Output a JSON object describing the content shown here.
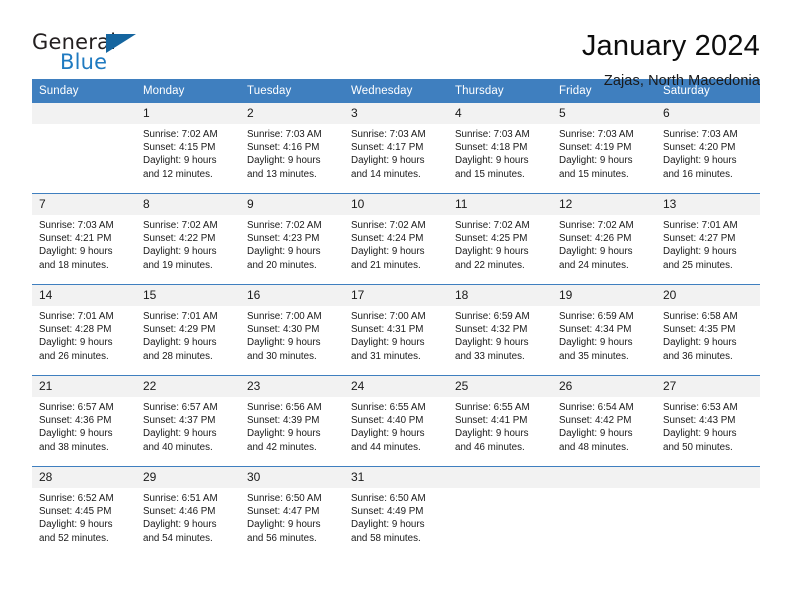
{
  "logo": {
    "word_one": "General",
    "word_two": "Blue",
    "triangle_color": "#15659f",
    "blue_text_color": "#1f7ac0"
  },
  "header": {
    "title": "January 2024",
    "subtitle": "Zajas, North Macedonia"
  },
  "theme": {
    "header_bg": "#3f7fbf",
    "header_text": "#ffffff",
    "daynum_bg": "#f2f2f2",
    "cell_bg": "#ffffff",
    "divider": "#3f7fbf"
  },
  "calendar": {
    "weekday_headers": [
      "Sunday",
      "Monday",
      "Tuesday",
      "Wednesday",
      "Thursday",
      "Friday",
      "Saturday"
    ],
    "weeks": [
      [
        {
          "day": "",
          "lines": []
        },
        {
          "day": "1",
          "lines": [
            "Sunrise: 7:02 AM",
            "Sunset: 4:15 PM",
            "Daylight: 9 hours",
            "and 12 minutes."
          ]
        },
        {
          "day": "2",
          "lines": [
            "Sunrise: 7:03 AM",
            "Sunset: 4:16 PM",
            "Daylight: 9 hours",
            "and 13 minutes."
          ]
        },
        {
          "day": "3",
          "lines": [
            "Sunrise: 7:03 AM",
            "Sunset: 4:17 PM",
            "Daylight: 9 hours",
            "and 14 minutes."
          ]
        },
        {
          "day": "4",
          "lines": [
            "Sunrise: 7:03 AM",
            "Sunset: 4:18 PM",
            "Daylight: 9 hours",
            "and 15 minutes."
          ]
        },
        {
          "day": "5",
          "lines": [
            "Sunrise: 7:03 AM",
            "Sunset: 4:19 PM",
            "Daylight: 9 hours",
            "and 15 minutes."
          ]
        },
        {
          "day": "6",
          "lines": [
            "Sunrise: 7:03 AM",
            "Sunset: 4:20 PM",
            "Daylight: 9 hours",
            "and 16 minutes."
          ]
        }
      ],
      [
        {
          "day": "7",
          "lines": [
            "Sunrise: 7:03 AM",
            "Sunset: 4:21 PM",
            "Daylight: 9 hours",
            "and 18 minutes."
          ]
        },
        {
          "day": "8",
          "lines": [
            "Sunrise: 7:02 AM",
            "Sunset: 4:22 PM",
            "Daylight: 9 hours",
            "and 19 minutes."
          ]
        },
        {
          "day": "9",
          "lines": [
            "Sunrise: 7:02 AM",
            "Sunset: 4:23 PM",
            "Daylight: 9 hours",
            "and 20 minutes."
          ]
        },
        {
          "day": "10",
          "lines": [
            "Sunrise: 7:02 AM",
            "Sunset: 4:24 PM",
            "Daylight: 9 hours",
            "and 21 minutes."
          ]
        },
        {
          "day": "11",
          "lines": [
            "Sunrise: 7:02 AM",
            "Sunset: 4:25 PM",
            "Daylight: 9 hours",
            "and 22 minutes."
          ]
        },
        {
          "day": "12",
          "lines": [
            "Sunrise: 7:02 AM",
            "Sunset: 4:26 PM",
            "Daylight: 9 hours",
            "and 24 minutes."
          ]
        },
        {
          "day": "13",
          "lines": [
            "Sunrise: 7:01 AM",
            "Sunset: 4:27 PM",
            "Daylight: 9 hours",
            "and 25 minutes."
          ]
        }
      ],
      [
        {
          "day": "14",
          "lines": [
            "Sunrise: 7:01 AM",
            "Sunset: 4:28 PM",
            "Daylight: 9 hours",
            "and 26 minutes."
          ]
        },
        {
          "day": "15",
          "lines": [
            "Sunrise: 7:01 AM",
            "Sunset: 4:29 PM",
            "Daylight: 9 hours",
            "and 28 minutes."
          ]
        },
        {
          "day": "16",
          "lines": [
            "Sunrise: 7:00 AM",
            "Sunset: 4:30 PM",
            "Daylight: 9 hours",
            "and 30 minutes."
          ]
        },
        {
          "day": "17",
          "lines": [
            "Sunrise: 7:00 AM",
            "Sunset: 4:31 PM",
            "Daylight: 9 hours",
            "and 31 minutes."
          ]
        },
        {
          "day": "18",
          "lines": [
            "Sunrise: 6:59 AM",
            "Sunset: 4:32 PM",
            "Daylight: 9 hours",
            "and 33 minutes."
          ]
        },
        {
          "day": "19",
          "lines": [
            "Sunrise: 6:59 AM",
            "Sunset: 4:34 PM",
            "Daylight: 9 hours",
            "and 35 minutes."
          ]
        },
        {
          "day": "20",
          "lines": [
            "Sunrise: 6:58 AM",
            "Sunset: 4:35 PM",
            "Daylight: 9 hours",
            "and 36 minutes."
          ]
        }
      ],
      [
        {
          "day": "21",
          "lines": [
            "Sunrise: 6:57 AM",
            "Sunset: 4:36 PM",
            "Daylight: 9 hours",
            "and 38 minutes."
          ]
        },
        {
          "day": "22",
          "lines": [
            "Sunrise: 6:57 AM",
            "Sunset: 4:37 PM",
            "Daylight: 9 hours",
            "and 40 minutes."
          ]
        },
        {
          "day": "23",
          "lines": [
            "Sunrise: 6:56 AM",
            "Sunset: 4:39 PM",
            "Daylight: 9 hours",
            "and 42 minutes."
          ]
        },
        {
          "day": "24",
          "lines": [
            "Sunrise: 6:55 AM",
            "Sunset: 4:40 PM",
            "Daylight: 9 hours",
            "and 44 minutes."
          ]
        },
        {
          "day": "25",
          "lines": [
            "Sunrise: 6:55 AM",
            "Sunset: 4:41 PM",
            "Daylight: 9 hours",
            "and 46 minutes."
          ]
        },
        {
          "day": "26",
          "lines": [
            "Sunrise: 6:54 AM",
            "Sunset: 4:42 PM",
            "Daylight: 9 hours",
            "and 48 minutes."
          ]
        },
        {
          "day": "27",
          "lines": [
            "Sunrise: 6:53 AM",
            "Sunset: 4:43 PM",
            "Daylight: 9 hours",
            "and 50 minutes."
          ]
        }
      ],
      [
        {
          "day": "28",
          "lines": [
            "Sunrise: 6:52 AM",
            "Sunset: 4:45 PM",
            "Daylight: 9 hours",
            "and 52 minutes."
          ]
        },
        {
          "day": "29",
          "lines": [
            "Sunrise: 6:51 AM",
            "Sunset: 4:46 PM",
            "Daylight: 9 hours",
            "and 54 minutes."
          ]
        },
        {
          "day": "30",
          "lines": [
            "Sunrise: 6:50 AM",
            "Sunset: 4:47 PM",
            "Daylight: 9 hours",
            "and 56 minutes."
          ]
        },
        {
          "day": "31",
          "lines": [
            "Sunrise: 6:50 AM",
            "Sunset: 4:49 PM",
            "Daylight: 9 hours",
            "and 58 minutes."
          ]
        },
        {
          "day": "",
          "lines": []
        },
        {
          "day": "",
          "lines": []
        },
        {
          "day": "",
          "lines": []
        }
      ]
    ]
  }
}
